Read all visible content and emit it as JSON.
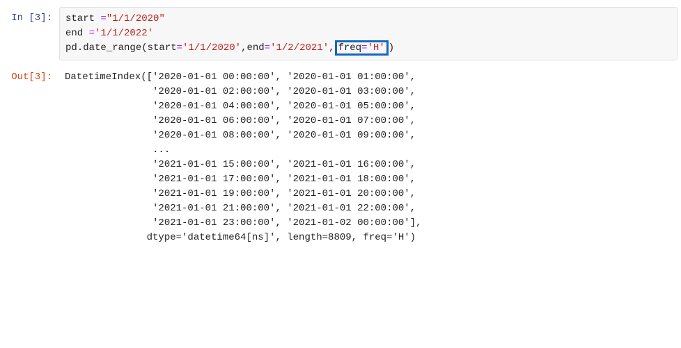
{
  "prompt_in": "In [3]:",
  "prompt_out": "Out[3]:",
  "code": {
    "line1_var": "start ",
    "line1_eq": "=",
    "line1_str": "\"1/1/2020\"",
    "line2_var": "end ",
    "line2_eq": "=",
    "line2_str": "'1/1/2022'",
    "line3_call": "pd.date_range(start",
    "line3_eq1": "=",
    "line3_arg1": "'1/1/2020'",
    "line3_sep1": ",end",
    "line3_eq2": "=",
    "line3_arg2": "'1/2/2021'",
    "line3_sep2": ",",
    "line3_freq": "freq",
    "line3_eq3": "=",
    "line3_arg3": "'H'",
    "line3_close": ")"
  },
  "output": {
    "line1": "DatetimeIndex(['2020-01-01 00:00:00', '2020-01-01 01:00:00',",
    "line2": "               '2020-01-01 02:00:00', '2020-01-01 03:00:00',",
    "line3": "               '2020-01-01 04:00:00', '2020-01-01 05:00:00',",
    "line4": "               '2020-01-01 06:00:00', '2020-01-01 07:00:00',",
    "line5": "               '2020-01-01 08:00:00', '2020-01-01 09:00:00',",
    "line6": "               ...",
    "line7": "               '2021-01-01 15:00:00', '2021-01-01 16:00:00',",
    "line8": "               '2021-01-01 17:00:00', '2021-01-01 18:00:00',",
    "line9": "               '2021-01-01 19:00:00', '2021-01-01 20:00:00',",
    "line10": "               '2021-01-01 21:00:00', '2021-01-01 22:00:00',",
    "line11": "               '2021-01-01 23:00:00', '2021-01-02 00:00:00'],",
    "line12": "              dtype='datetime64[ns]', length=8809, freq='H')"
  }
}
